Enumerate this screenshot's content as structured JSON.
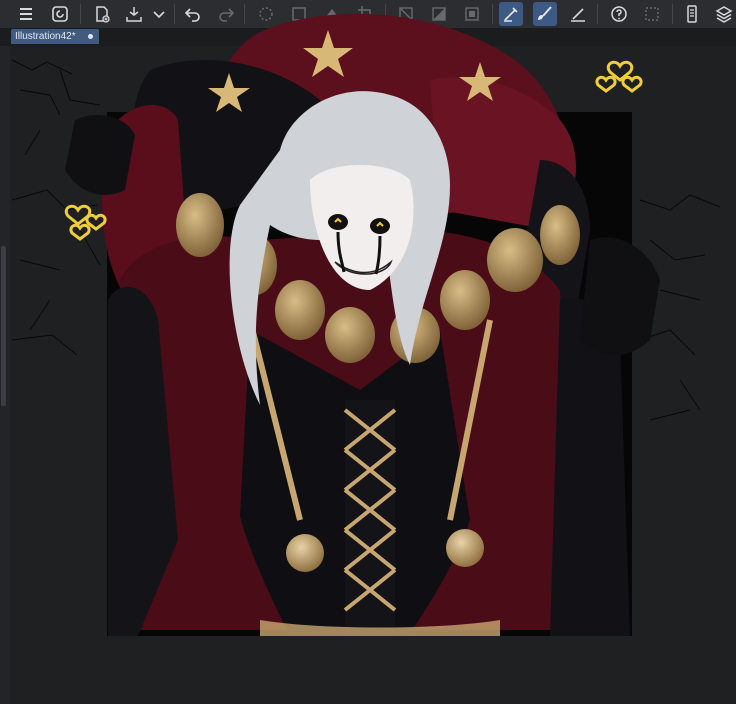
{
  "document": {
    "tab_title": "Illustration42*"
  },
  "toolbar": {
    "buttons": [
      {
        "name": "menu-icon"
      },
      {
        "name": "spiral-logo-icon"
      },
      {
        "name": "new-file-icon"
      },
      {
        "name": "save-tray-icon"
      },
      {
        "name": "chevron-down-icon"
      },
      {
        "name": "undo-icon"
      },
      {
        "name": "redo-icon"
      },
      {
        "name": "loading-spinner-icon"
      },
      {
        "name": "transform-icon"
      },
      {
        "name": "fill-icon"
      },
      {
        "name": "crop-icon"
      },
      {
        "name": "clear-selection-icon"
      },
      {
        "name": "tone-icon"
      },
      {
        "name": "select-frame-icon"
      },
      {
        "name": "pen-line-icon"
      },
      {
        "name": "brush-icon"
      },
      {
        "name": "ruler-pen-icon"
      },
      {
        "name": "help-icon"
      },
      {
        "name": "dashed-selection-icon"
      },
      {
        "name": "device-icon"
      },
      {
        "name": "layers-icon"
      }
    ]
  },
  "colors": {
    "toolbar_bg": "#2b2d31",
    "active_tool": "#3d5a85",
    "tab_active": "#405a80",
    "artwork_bg": "#060606",
    "jester_red": "#5c0f1c",
    "jester_black": "#111014",
    "gold": "#c7a66f",
    "hair": "#cfd2d6",
    "heart_yellow": "#f0cd3a"
  }
}
